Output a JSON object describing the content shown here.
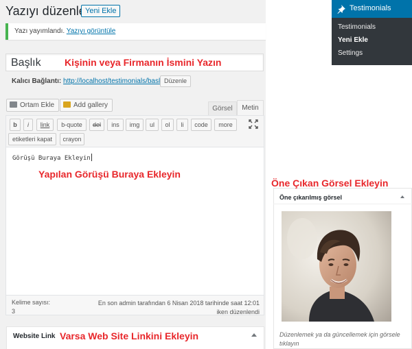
{
  "header": {
    "title": "Yazıyı düzenle",
    "add_new": "Yeni Ekle"
  },
  "notice": {
    "text": "Yazı yayımlandı.",
    "link": "Yazıyı görüntüle"
  },
  "title_field": {
    "value": "Başlık"
  },
  "permalink": {
    "label": "Kalıcı Bağlantı:",
    "url": "http://localhost/testimonials/baslik/",
    "edit": "Düzenle"
  },
  "media": {
    "add_media": "Ortam Ekle",
    "add_gallery": "Add gallery"
  },
  "editor_tabs": {
    "visual": "Görsel",
    "text": "Metin"
  },
  "quicktags": {
    "row1": [
      "b",
      "i",
      "link",
      "b-quote",
      "del",
      "ins",
      "img",
      "ul",
      "ol",
      "li",
      "code",
      "more"
    ],
    "row2": [
      "etiketleri kapat",
      "crayon"
    ]
  },
  "editor": {
    "content": "Görüşü Buraya Ekleyin"
  },
  "status": {
    "word_count_label": "Kelime sayısı:",
    "word_count": "3",
    "last_edit": "En son admin tarafından 6 Nisan 2018 tarihinde saat 12:01 iken düzenlendi"
  },
  "website_link": {
    "title": "Website Link"
  },
  "admin_menu": {
    "head": "Testimonials",
    "items": [
      "Testimonials",
      "Yeni Ekle",
      "Settings"
    ]
  },
  "featured": {
    "title": "Öne çıkarılmış görsel",
    "help": "Düzenlemek ya da güncellemek için görsele tıklayın"
  },
  "annotations": {
    "title": "Kişinin veya Firmanın İsmini Yazın",
    "review": "Yapılan Görüşü Buraya Ekleyin",
    "featured": "Öne Çıkan Görsel Ekleyin",
    "weblink": "Varsa Web Site Linkini Ekleyin"
  },
  "colors": {
    "accent": "#0073aa",
    "annotation": "#e8272b",
    "notice_border": "#46b450",
    "admin_menu_bg": "#32373c"
  }
}
